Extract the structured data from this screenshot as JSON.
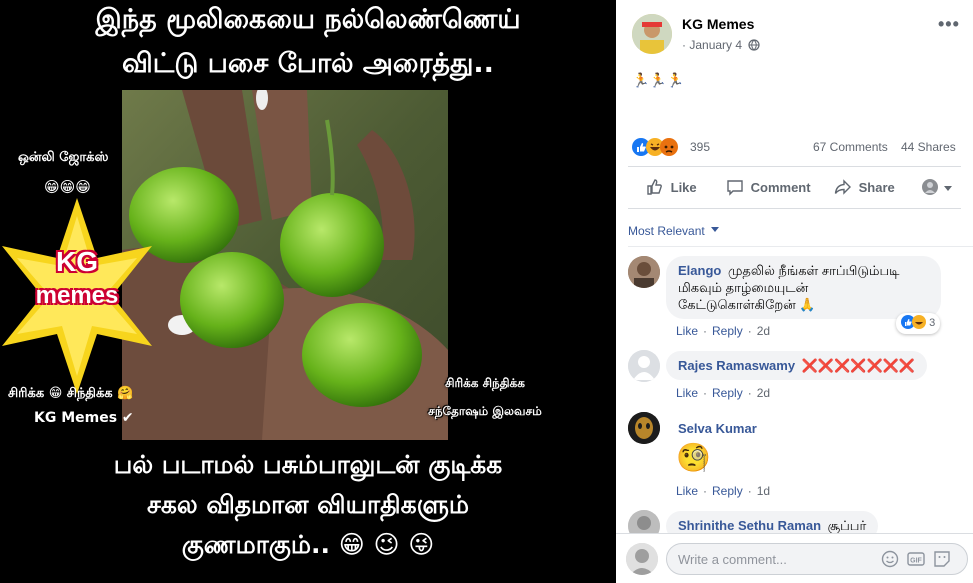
{
  "meme": {
    "top_line1": "இந்த மூலிகையை நல்லெண்ணெய்",
    "top_line2": "விட்டு பசை போல் அரைத்து..",
    "bottom_line1": "பல் படாமல் பசும்பாலுடன் குடிக்க",
    "bottom_line2": "சகல விதமான வியாதிகளும்",
    "bottom_line3": "குணமாகும்..",
    "side_top": "ஒன்லி ஜோக்ஸ்",
    "side_star_line1": "KG",
    "side_star_line2": "memes",
    "side_bottom1": "சிரிக்க 😁 சிந்திக்க 🤗",
    "side_bottom2": "KG Memes ✔",
    "badge_line1": "சிரிக்க சிந்திக்க",
    "badge_line2": "சந்தோஷம் இலவசம்"
  },
  "post": {
    "author": "KG Memes",
    "date": "January 4",
    "separator": "·",
    "body": "🏃🏃🏃",
    "reaction_count": "395",
    "comments_count": "67 Comments",
    "shares_count": "44 Shares",
    "actions": {
      "like": "Like",
      "comment": "Comment",
      "share": "Share"
    },
    "sort_label": "Most Relevant"
  },
  "comments": [
    {
      "name": "Elango",
      "text": "முதலில் நீங்கள் சாப்பிடும்படி மிகவும் தாழ்மையுடன் கேட்டுகொள்கிறேன் 🙏",
      "like": "Like",
      "reply": "Reply",
      "time": "2d",
      "reactions": "3"
    },
    {
      "name": "Rajes Ramaswamy",
      "text": "❌❌❌❌❌❌❌",
      "like": "Like",
      "reply": "Reply",
      "time": "2d"
    },
    {
      "name": "Selva Kumar",
      "text": "🧐",
      "like": "Like",
      "reply": "Reply",
      "time": "1d"
    },
    {
      "name": "Shrinithe Sethu Raman",
      "text": "சூப்பர்"
    }
  ],
  "composer": {
    "placeholder": "Write a comment..."
  },
  "colors": {
    "link": "#385898",
    "muted": "#616770",
    "bubble": "#f2f3f5",
    "meme_bg": "#000000",
    "star_yellow": "#f7d51d"
  }
}
